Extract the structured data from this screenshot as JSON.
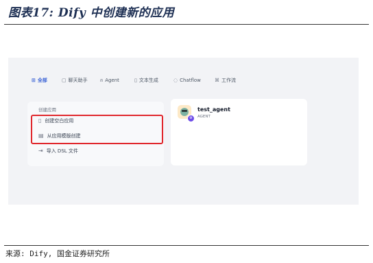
{
  "figure": {
    "title": "图表17: Dify 中创建新的应用",
    "source": "来源: Dify, 国金证券研究所"
  },
  "tabs": [
    {
      "label": "全部",
      "icon": "grid-icon",
      "glyph": "⊞",
      "active": true
    },
    {
      "label": "聊天助手",
      "icon": "chat-icon",
      "glyph": "▢"
    },
    {
      "label": "Agent",
      "icon": "agent-icon",
      "glyph": "⍝"
    },
    {
      "label": "文本生成",
      "icon": "document-icon",
      "glyph": "▯"
    },
    {
      "label": "Chatflow",
      "icon": "chatflow-icon",
      "glyph": "◌"
    },
    {
      "label": "工作流",
      "icon": "workflow-icon",
      "glyph": "⌘"
    }
  ],
  "create_card": {
    "heading": "创建应用",
    "items": [
      {
        "label": "创建空白应用",
        "icon": "blank-file-icon",
        "glyph": "▯"
      },
      {
        "label": "从应用模版创建",
        "icon": "template-icon",
        "glyph": "▤"
      },
      {
        "label": "导入 DSL 文件",
        "icon": "import-icon",
        "glyph": "⇥"
      }
    ]
  },
  "app_card": {
    "name": "test_agent",
    "type": "AGENT",
    "icon": "robot-avatar-icon",
    "badge_icon": "agent-badge-icon",
    "badge_color": "#6d4ce8"
  },
  "colors": {
    "accent": "#3c64d6",
    "highlight": "#e0262b",
    "title": "#1d2f53"
  }
}
